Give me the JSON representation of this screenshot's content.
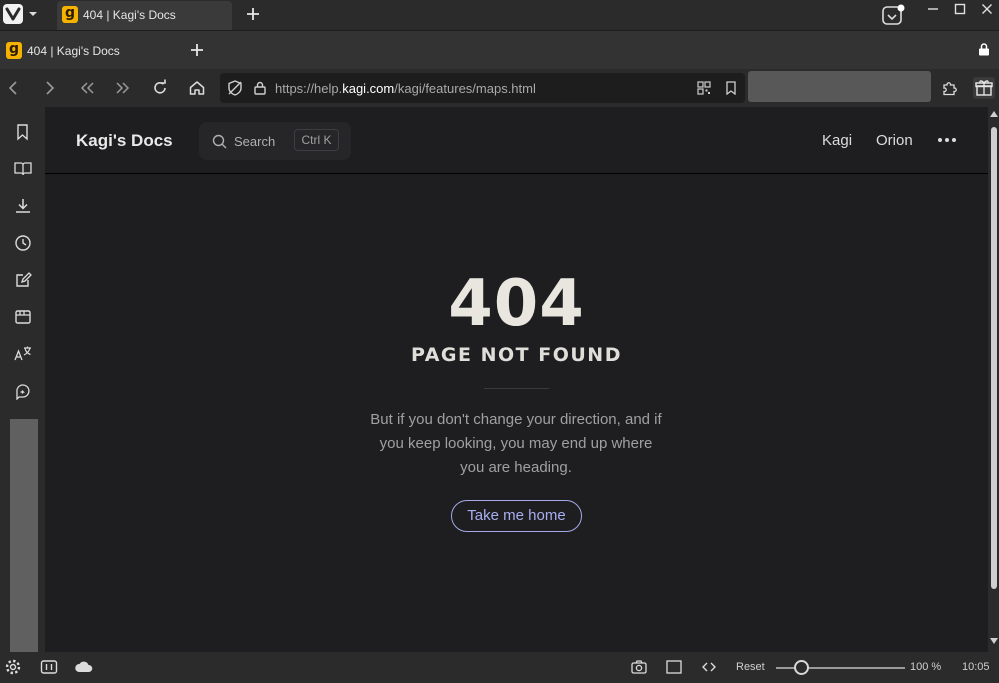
{
  "browser": {
    "tab_title": "404 | Kagi's Docs",
    "favicon_letter": "g",
    "url_prefix": "https://help.",
    "url_domain": "kagi.com",
    "url_path": "/kagi/features/maps.html",
    "zoom_reset_label": "Reset",
    "zoom_value": "100 %",
    "zoom_level_fraction": 0.2,
    "clock": "10:05"
  },
  "sidebar": {
    "icons": [
      "bookmarks-icon",
      "reading-list-icon",
      "downloads-icon",
      "history-icon",
      "notes-icon",
      "window-panel-icon",
      "translate-icon",
      "feed-icon"
    ]
  },
  "docs": {
    "site_title": "Kagi's Docs",
    "search_placeholder": "Search",
    "search_shortcut": "Ctrl K",
    "nav_links": [
      "Kagi",
      "Orion"
    ]
  },
  "error": {
    "code": "404",
    "title": "PAGE NOT FOUND",
    "message": "But if you don't change your direction, and if you keep looking, you may end up where you are heading.",
    "home_button": "Take me home"
  },
  "colors": {
    "favicon": "#f5b300",
    "button_accent": "#a4a9e8",
    "page_bg": "#1e1e20"
  }
}
